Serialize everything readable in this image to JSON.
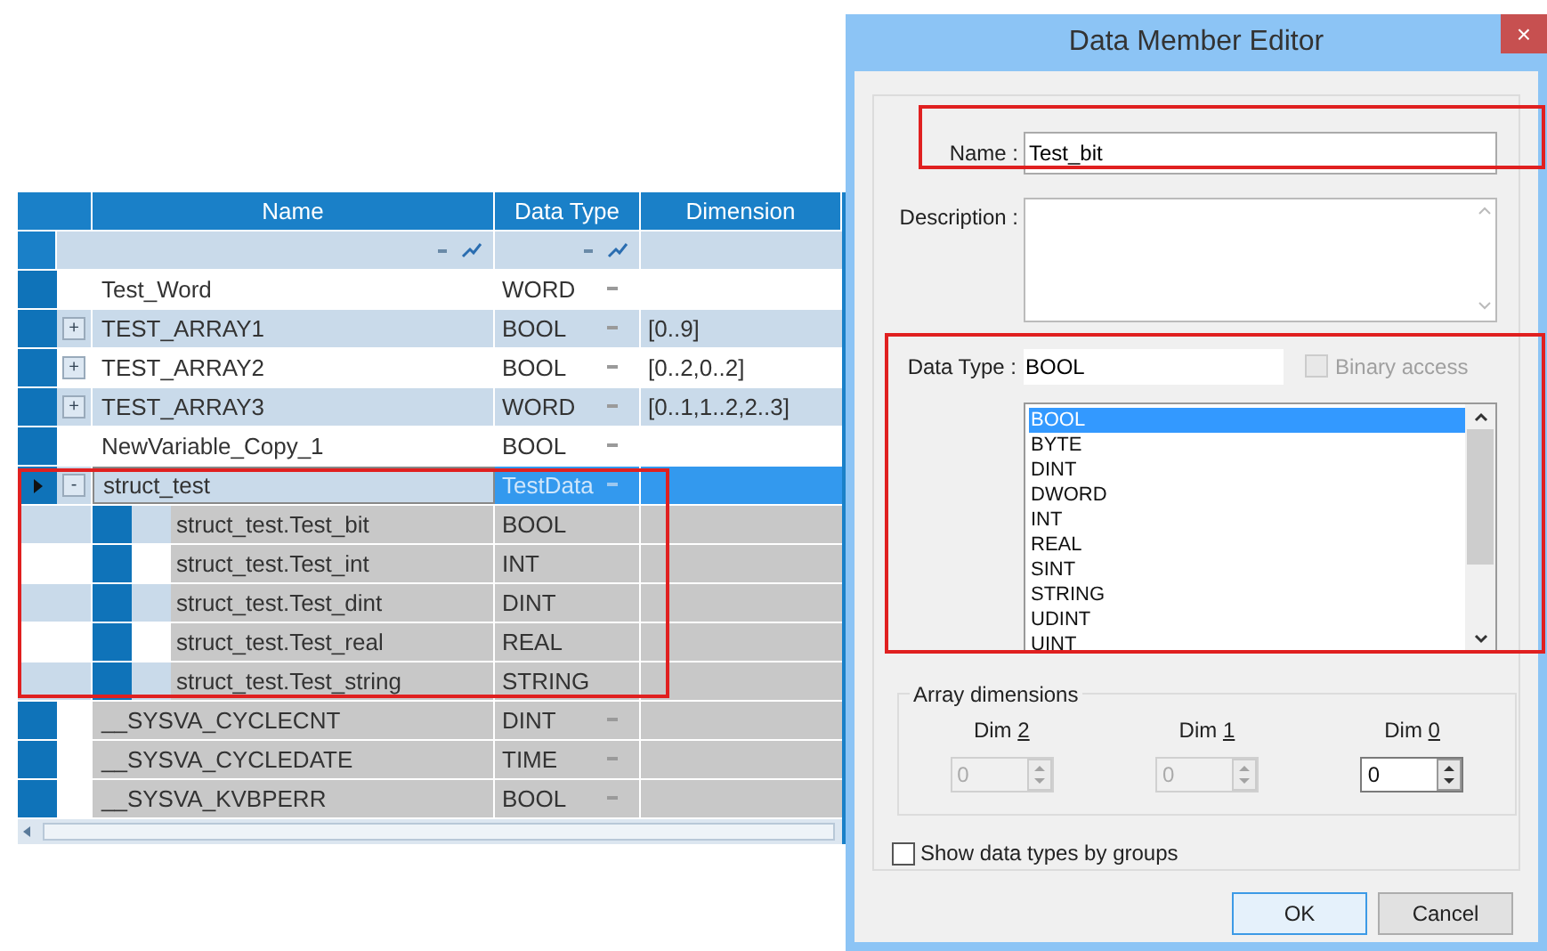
{
  "grid": {
    "columns": [
      "Name",
      "Data Type",
      "Dimension"
    ],
    "rows": [
      {
        "kind": "variable",
        "name": "Test_Word",
        "data_type": "WORD",
        "selected": false
      },
      {
        "kind": "variable",
        "expander": "+",
        "name": "TEST_ARRAY1",
        "data_type": "BOOL",
        "dimension": "[0..9]",
        "selected": false
      },
      {
        "kind": "variable",
        "expander": "+",
        "name": "TEST_ARRAY2",
        "data_type": "BOOL",
        "dimension": "[0..2,0..2]",
        "selected": false
      },
      {
        "kind": "variable",
        "expander": "+",
        "name": "TEST_ARRAY3",
        "data_type": "WORD",
        "dimension": "[0..1,1..2,2..3]",
        "selected": false
      },
      {
        "kind": "variable",
        "name": "NewVariable_Copy_1",
        "data_type": "BOOL",
        "selected": false
      },
      {
        "kind": "variable",
        "expander": "-",
        "name": "struct_test",
        "data_type": "TestData",
        "selected": true
      },
      {
        "kind": "member",
        "name": "struct_test.Test_bit",
        "data_type": "BOOL",
        "selected": false
      },
      {
        "kind": "member",
        "name": "struct_test.Test_int",
        "data_type": "INT",
        "selected": false
      },
      {
        "kind": "member",
        "name": "struct_test.Test_dint",
        "data_type": "DINT",
        "selected": false
      },
      {
        "kind": "member",
        "name": "struct_test.Test_real",
        "data_type": "REAL",
        "selected": false
      },
      {
        "kind": "member",
        "name": "struct_test.Test_string",
        "data_type": "STRING",
        "selected": false
      },
      {
        "kind": "system",
        "name": "__SYSVA_CYCLECNT",
        "data_type": "DINT",
        "selected": false
      },
      {
        "kind": "system",
        "name": "__SYSVA_CYCLEDATE",
        "data_type": "TIME",
        "selected": false
      },
      {
        "kind": "system",
        "name": "__SYSVA_KVBPERR",
        "data_type": "BOOL",
        "selected": false
      }
    ]
  },
  "dialog": {
    "title": "Data Member Editor",
    "close": "×",
    "name_label": "Name :",
    "name_value": "Test_bit",
    "description_label": "Description :",
    "data_type_label": "Data Type :",
    "data_type_value": "BOOL",
    "binary_access": {
      "label": "Binary access",
      "checked": false,
      "disabled": true
    },
    "types": [
      {
        "label": "BOOL",
        "selected": true
      },
      {
        "label": "BYTE",
        "selected": false
      },
      {
        "label": "DINT",
        "selected": false
      },
      {
        "label": "DWORD",
        "selected": false
      },
      {
        "label": "INT",
        "selected": false
      },
      {
        "label": "REAL",
        "selected": false
      },
      {
        "label": "SINT",
        "selected": false
      },
      {
        "label": "STRING",
        "selected": false
      },
      {
        "label": "UDINT",
        "selected": false
      },
      {
        "label": "UINT",
        "selected": false
      }
    ],
    "array_dimensions": {
      "title": "Array dimensions",
      "dims": [
        {
          "label": "Dim",
          "key": "2",
          "value": "0",
          "disabled": true
        },
        {
          "label": "Dim",
          "key": "1",
          "value": "0",
          "disabled": true
        },
        {
          "label": "Dim",
          "key": "0",
          "value": "0",
          "disabled": false
        }
      ]
    },
    "show_by_groups": {
      "label": "Show data types by groups",
      "checked": false
    },
    "buttons": [
      {
        "label": "OK",
        "default": true
      },
      {
        "label": "Cancel",
        "default": false
      }
    ]
  }
}
